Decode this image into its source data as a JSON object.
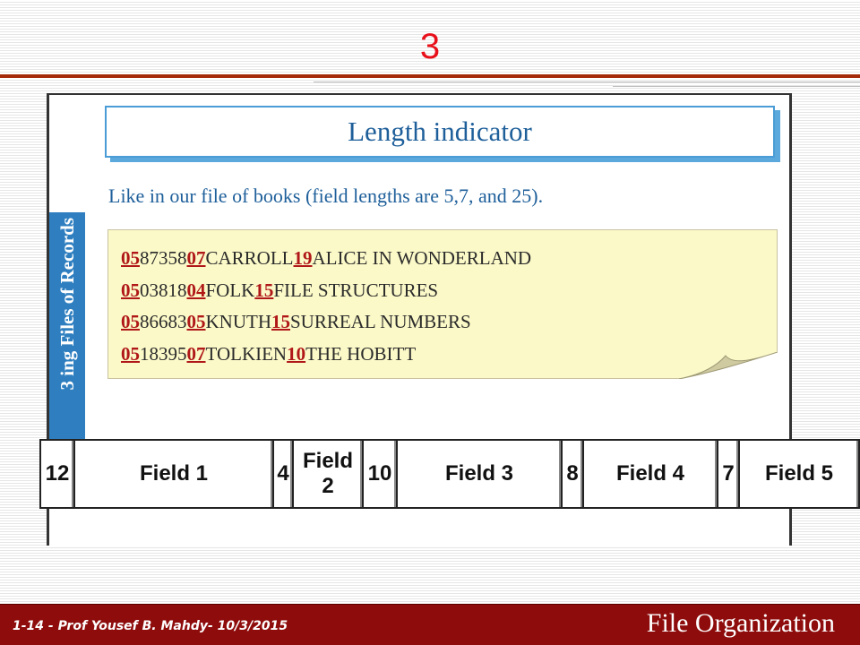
{
  "slide": {
    "number": "3"
  },
  "book": {
    "side_tab": "3   ing Files of Records",
    "title": "Length indicator",
    "description": "Like in our file of books (field lengths are 5,7, and 25).",
    "records": [
      [
        {
          "t": "05",
          "len": true
        },
        {
          "t": "87358",
          "len": false
        },
        {
          "t": "07",
          "len": true
        },
        {
          "t": "CARROLL",
          "len": false
        },
        {
          "t": "19",
          "len": true
        },
        {
          "t": "ALICE IN WONDERLAND",
          "len": false
        }
      ],
      [
        {
          "t": "05",
          "len": true
        },
        {
          "t": "03818",
          "len": false
        },
        {
          "t": "04",
          "len": true
        },
        {
          "t": "FOLK",
          "len": false
        },
        {
          "t": "15",
          "len": true
        },
        {
          "t": "FILE STRUCTURES",
          "len": false
        }
      ],
      [
        {
          "t": "05",
          "len": true
        },
        {
          "t": "86683",
          "len": false
        },
        {
          "t": "05",
          "len": true
        },
        {
          "t": "KNUTH",
          "len": false
        },
        {
          "t": "15",
          "len": true
        },
        {
          "t": "SURREAL NUMBERS",
          "len": false
        }
      ],
      [
        {
          "t": "05",
          "len": true
        },
        {
          "t": "18395",
          "len": false
        },
        {
          "t": "07",
          "len": true
        },
        {
          "t": "TOLKIEN",
          "len": false
        },
        {
          "t": "10",
          "len": true
        },
        {
          "t": "THE HOBITT",
          "len": false
        }
      ]
    ]
  },
  "field_table": {
    "cells": [
      {
        "text": "12",
        "kind": "length"
      },
      {
        "text": "Field 1",
        "kind": "field"
      },
      {
        "text": "4",
        "kind": "length"
      },
      {
        "text": "Field 2",
        "kind": "field"
      },
      {
        "text": "10",
        "kind": "length"
      },
      {
        "text": "Field 3",
        "kind": "field"
      },
      {
        "text": "8",
        "kind": "length"
      },
      {
        "text": "Field 4",
        "kind": "field"
      },
      {
        "text": "7",
        "kind": "length"
      },
      {
        "text": "Field 5",
        "kind": "field"
      }
    ]
  },
  "footer": {
    "left": "1-14 - Prof  Yousef  B. Mahdy- 10/3/2015",
    "right": "File Organization"
  },
  "colors": {
    "slide_number": "#e8101a",
    "rule": "#a52a0a",
    "footer_bg": "#8e0c0c",
    "book_blue": "#1e5f9a",
    "length_red": "#b01818",
    "note_bg": "#fbf9c8"
  }
}
